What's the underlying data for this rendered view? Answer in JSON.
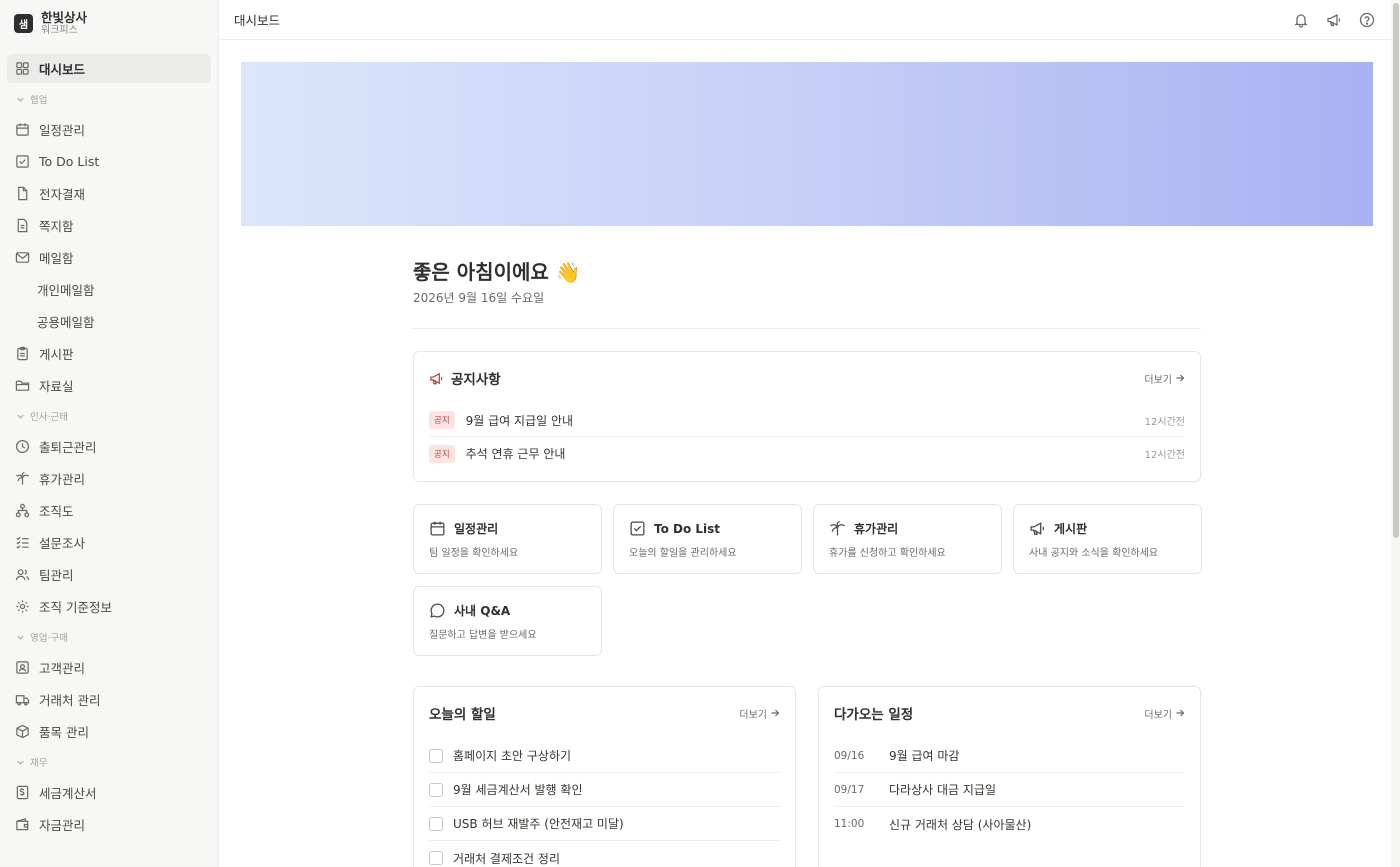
{
  "workspace": {
    "logo": "샘",
    "name": "한빛상사",
    "sub": "워크피스"
  },
  "sidebar": {
    "dashboard": "대시보드",
    "sections": {
      "collab": "협업",
      "hr": "인사·근태",
      "sales": "영업·구매",
      "finance": "재무"
    },
    "items": {
      "schedule": "일정관리",
      "todo": "To Do List",
      "approval": "전자결재",
      "memo": "쪽지함",
      "mail": "메일함",
      "mail_personal": "개인메일함",
      "mail_shared": "공용메일함",
      "board": "게시판",
      "files": "자료실",
      "attendance": "출퇴근관리",
      "leave": "휴가관리",
      "org": "조직도",
      "survey": "설문조사",
      "team": "팀관리",
      "org_standard": "조직 기준정보",
      "customer": "고객관리",
      "vendor": "거래처 관리",
      "product": "품목 관리",
      "tax_invoice": "세금계산서",
      "funds": "자금관리"
    }
  },
  "header": {
    "title": "대시보드"
  },
  "greeting": {
    "text": "좋은 아침이에요 👋",
    "date": "2026년 9월 16일 수요일"
  },
  "notices": {
    "title": "공지사항",
    "more": "더보기",
    "tag": "공지",
    "items": [
      {
        "title": "9월 급여 지급일 안내",
        "time": "12시간전"
      },
      {
        "title": "추석 연휴 근무 안내",
        "time": "12시간전"
      }
    ]
  },
  "quick_links": [
    {
      "title": "일정관리",
      "desc": "팀 일정을 확인하세요",
      "icon": "calendar-icon"
    },
    {
      "title": "To Do List",
      "desc": "오늘의 할일을 관리하세요",
      "icon": "checkbox-icon"
    },
    {
      "title": "휴가관리",
      "desc": "휴가를 신청하고 확인하세요",
      "icon": "palm-tree-icon"
    },
    {
      "title": "게시판",
      "desc": "사내 공지와 소식을 확인하세요",
      "icon": "megaphone-icon"
    },
    {
      "title": "사내 Q&A",
      "desc": "질문하고 답변을 받으세요",
      "icon": "chat-bubble-icon"
    }
  ],
  "todos": {
    "title": "오늘의 할일",
    "more": "더보기",
    "items": [
      "홈페이지 초안 구상하기",
      "9월 세금계산서 발행 확인",
      "USB 허브 재발주 (안전재고 미달)",
      "거래처 결제조건 정리"
    ]
  },
  "upcoming": {
    "title": "다가오는 일정",
    "more": "더보기",
    "items": [
      {
        "date": "09/16",
        "title": "9월 급여 마감"
      },
      {
        "date": "09/17",
        "title": "다라상사 대금 지급일"
      },
      {
        "date": "11:00",
        "title": "신규 거래처 상담 (사아물산)"
      }
    ]
  },
  "colors": {
    "accent_red": "#c0483f",
    "banner_start": "#dbe6fb",
    "banner_end": "#a8b2f2"
  }
}
